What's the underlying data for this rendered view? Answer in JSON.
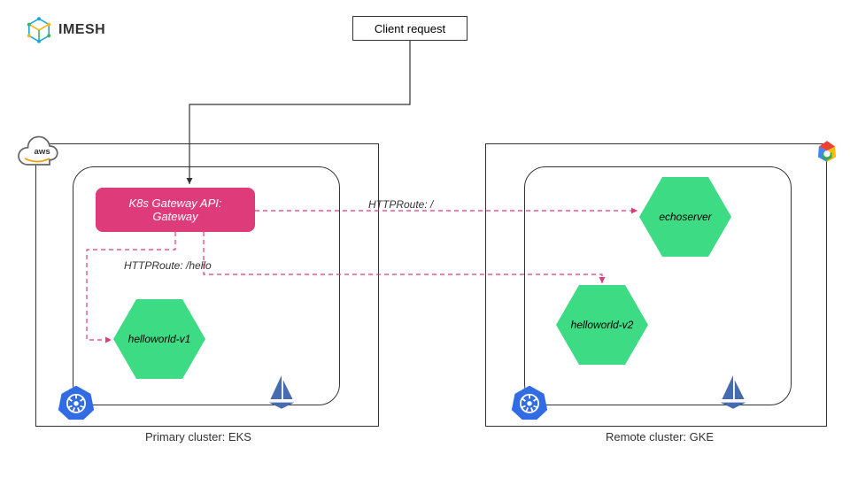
{
  "logo": {
    "text": "IMESH"
  },
  "client": {
    "label": "Client request"
  },
  "clusters": {
    "primary": {
      "label": "Primary cluster: EKS",
      "provider": "aws"
    },
    "remote": {
      "label": "Remote cluster: GKE",
      "provider": "gcp"
    }
  },
  "gateway": {
    "line1": "K8s Gateway API:",
    "line2": "Gateway"
  },
  "services": {
    "helloworld_v1": "helloworld-v1",
    "helloworld_v2": "helloworld-v2",
    "echoserver": "echoserver"
  },
  "routes": {
    "hello": "HTTPRoute: /hello",
    "root": "HTTPRoute: /"
  },
  "icons": {
    "k8s": "kubernetes-icon",
    "istio": "istio-icon",
    "aws": "aws-icon",
    "gcp": "gcp-icon"
  }
}
